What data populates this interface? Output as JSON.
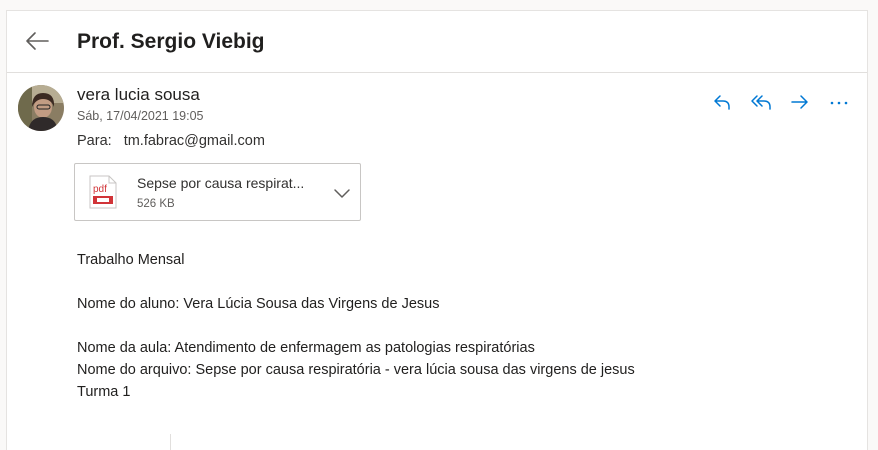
{
  "header": {
    "subject": "Prof. Sergio Viebig",
    "back_icon": "arrow-left-icon"
  },
  "message": {
    "sender_name": "vera lucia sousa",
    "sent_date": "Sáb, 17/04/2021 19:05",
    "to_label": "Para:",
    "to_address": "tm.fabrac@gmail.com",
    "actions": [
      {
        "name": "reply",
        "icon": "reply-icon"
      },
      {
        "name": "reply-all",
        "icon": "reply-all-icon"
      },
      {
        "name": "forward",
        "icon": "forward-icon"
      },
      {
        "name": "more",
        "icon": "more-icon"
      }
    ]
  },
  "attachment": {
    "name": "Sepse por causa respirat...",
    "size": "526 KB",
    "type_icon": "pdf-icon"
  },
  "body": {
    "line1": "Trabalho Mensal",
    "line2": "Nome do aluno: Vera Lúcia Sousa das Virgens de Jesus",
    "line3": "Nome da aula: Atendimento de enfermagem as patologias respiratórias",
    "line4": "Nome do arquivo: Sepse por causa respiratória - vera lúcia sousa das virgens de jesus",
    "line5": "Turma 1"
  },
  "colors": {
    "accent": "#0078d4",
    "pdf_red": "#d13438"
  }
}
